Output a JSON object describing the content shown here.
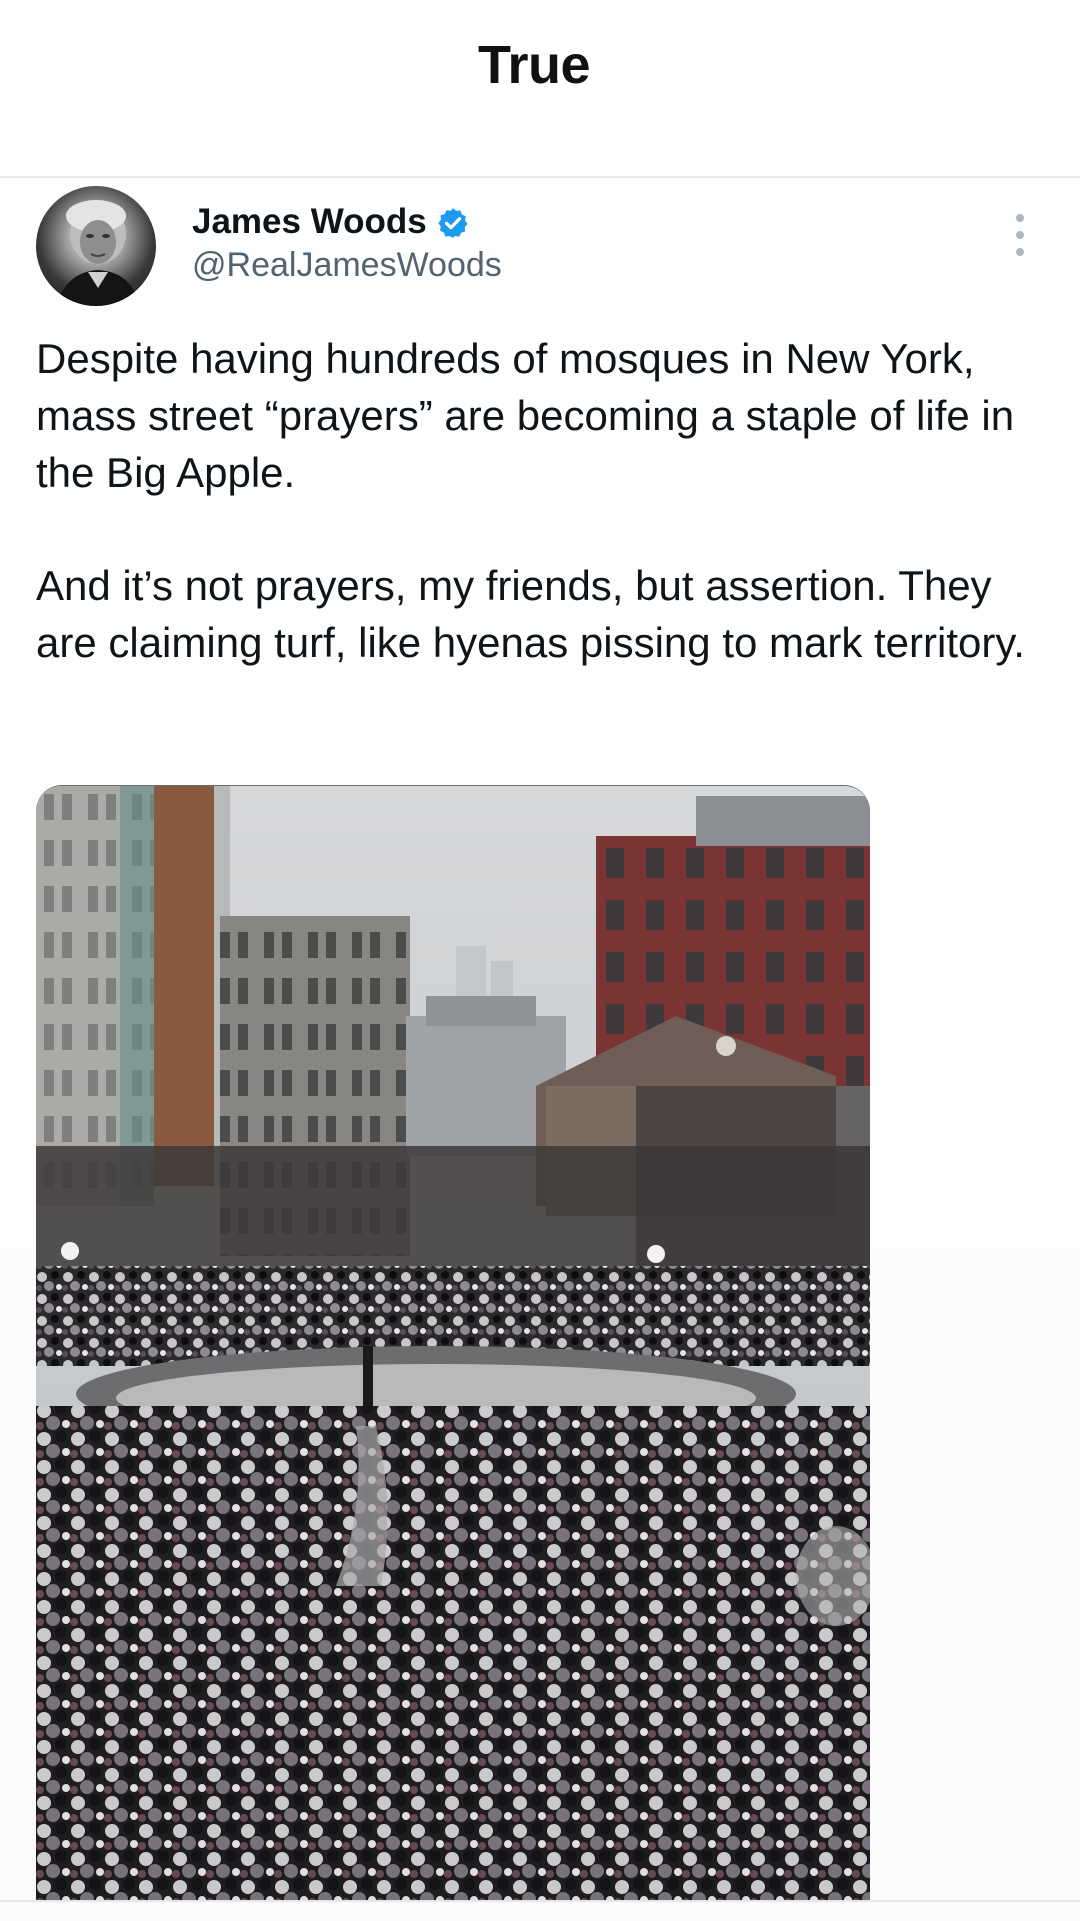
{
  "header": {
    "title": "True"
  },
  "post": {
    "author": {
      "name": "James Woods",
      "handle": "@RealJamesWoods",
      "verified": true
    },
    "paragraphs": [
      "Despite having hundreds of mosques in New York, mass street “prayers” are becoming a staple of life in the Big Apple.",
      "And it’s not prayers, my friends, but assertion. They are claiming turf, like hyenas pissing to mark territory."
    ]
  },
  "icons": {
    "verified": "verified-badge-icon",
    "more": "more-vertical-icon"
  },
  "colors": {
    "verified": "#1d9bf0",
    "handle": "#536471",
    "text": "#0f1419",
    "divider": "#e7e9eb"
  }
}
